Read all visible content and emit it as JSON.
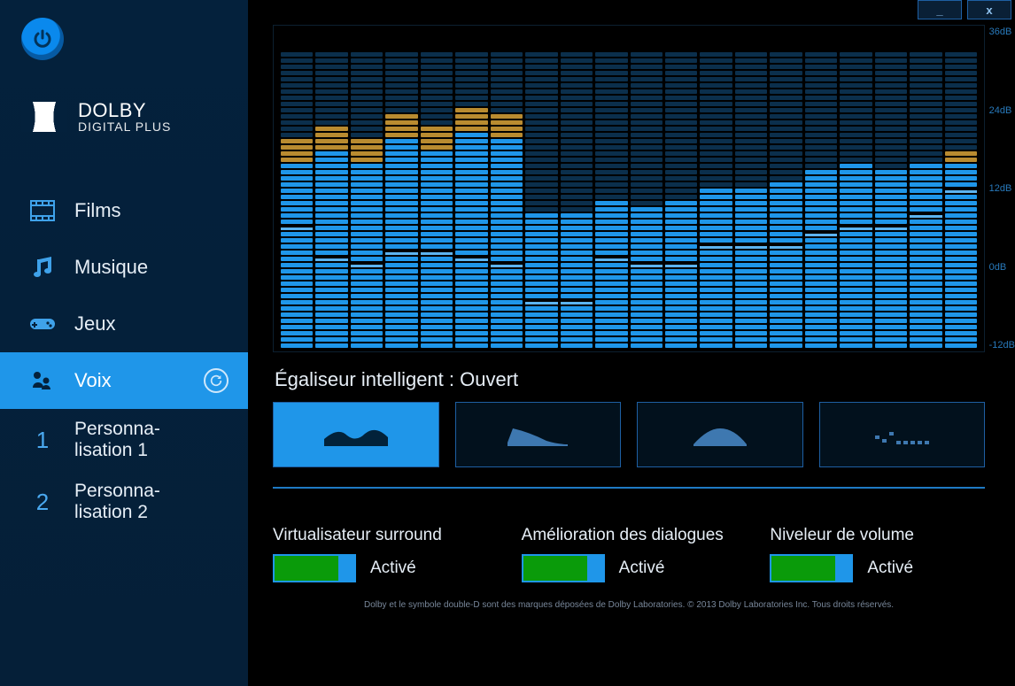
{
  "window": {
    "minimize": "_",
    "close": "x"
  },
  "logo": {
    "top": "DOLBY",
    "bot": "DIGITAL PLUS"
  },
  "sidebar": {
    "items": [
      {
        "id": "films",
        "label": "Films"
      },
      {
        "id": "musique",
        "label": "Musique"
      },
      {
        "id": "jeux",
        "label": "Jeux"
      },
      {
        "id": "voix",
        "label": "Voix"
      },
      {
        "id": "p1",
        "num": "1",
        "line1": "Personna-",
        "line2": "lisation 1"
      },
      {
        "id": "p2",
        "num": "2",
        "line1": "Personna-",
        "line2": "lisation 2"
      }
    ]
  },
  "equalizer_label": "Égaliseur intelligent : Ouvert",
  "axis": {
    "l0": "36dB",
    "l1": "24dB",
    "l2": "12dB",
    "l3": "0dB",
    "l4": "-12dB"
  },
  "features": {
    "f0": {
      "title": "Virtualisateur surround",
      "state": "Activé"
    },
    "f1": {
      "title": "Amélioration des dialogues",
      "state": "Activé"
    },
    "f2": {
      "title": "Niveleur de volume",
      "state": "Activé"
    }
  },
  "footer": "Dolby et le symbole double-D sont des marques déposées de Dolby Laboratories. © 2013 Dolby Laboratories Inc. Tous droits réservés.",
  "chart_data": {
    "type": "bar",
    "title": "Égaliseur intelligent",
    "ylabel": "dB",
    "ylim": [
      -12,
      36
    ],
    "bands": 20,
    "values": [
      22,
      24,
      22,
      26,
      24,
      27,
      26,
      10,
      10,
      12,
      11,
      12,
      14,
      14,
      15,
      17,
      18,
      17,
      18,
      20
    ],
    "markers": [
      8,
      3,
      2,
      4,
      4,
      3,
      2,
      -4,
      -4,
      3,
      2,
      2,
      5,
      5,
      5,
      7,
      8,
      8,
      10,
      14
    ]
  }
}
